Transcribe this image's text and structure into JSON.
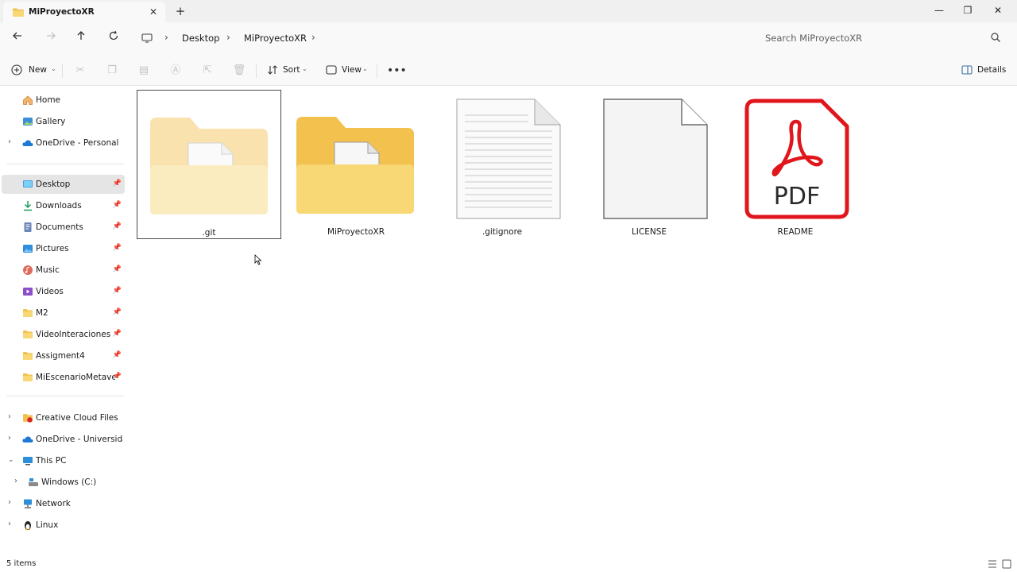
{
  "window": {
    "tab_title": "MiProyectoXR",
    "tab_close": "✕",
    "new_tab": "+",
    "minimize": "—",
    "restore": "❐",
    "close": "✕"
  },
  "address": {
    "crumbs": [
      "Desktop",
      "MiProyectoXR"
    ],
    "search_placeholder": "Search MiProyectoXR"
  },
  "commands": {
    "new_label": "New",
    "sort_label": "Sort",
    "view_label": "View",
    "details_label": "Details"
  },
  "sidebar": {
    "quick": [
      {
        "label": "Home",
        "icon": "home-icon"
      },
      {
        "label": "Gallery",
        "icon": "gallery-icon"
      },
      {
        "label": "OneDrive - Personal",
        "icon": "onedrive-icon"
      }
    ],
    "pinned": [
      {
        "label": "Desktop",
        "icon": "desktop-icon",
        "selected": true
      },
      {
        "label": "Downloads",
        "icon": "download-icon"
      },
      {
        "label": "Documents",
        "icon": "documents-icon"
      },
      {
        "label": "Pictures",
        "icon": "pictures-icon"
      },
      {
        "label": "Music",
        "icon": "music-icon"
      },
      {
        "label": "Videos",
        "icon": "videos-icon"
      },
      {
        "label": "M2",
        "icon": "folder-icon"
      },
      {
        "label": "VideoInteraciones",
        "icon": "folder-icon"
      },
      {
        "label": "Assigment4",
        "icon": "folder-icon"
      },
      {
        "label": "MiEscenarioMetaversc",
        "icon": "folder-icon"
      }
    ],
    "locations": [
      {
        "label": "Creative Cloud Files",
        "icon": "creative-cloud-icon"
      },
      {
        "label": "OneDrive - Universidad d",
        "icon": "onedrive-icon"
      },
      {
        "label": "This PC",
        "icon": "pc-icon"
      },
      {
        "label": "Windows (C:)",
        "icon": "drive-icon"
      },
      {
        "label": "Network",
        "icon": "network-icon"
      },
      {
        "label": "Linux",
        "icon": "linux-icon"
      }
    ]
  },
  "files": [
    {
      "name": ".git",
      "type": "folder-faded"
    },
    {
      "name": "MiProyectoXR",
      "type": "folder"
    },
    {
      "name": ".gitignore",
      "type": "text-file"
    },
    {
      "name": "LICENSE",
      "type": "blank-file"
    },
    {
      "name": "README",
      "type": "pdf",
      "pdf_text": "PDF"
    }
  ],
  "status": {
    "count": "5 items"
  },
  "colors": {
    "folder": "#f2c14e",
    "folder_front": "#f8d775",
    "pdf_red": "#e0161c",
    "selected_bg": "#e5e5e5"
  }
}
